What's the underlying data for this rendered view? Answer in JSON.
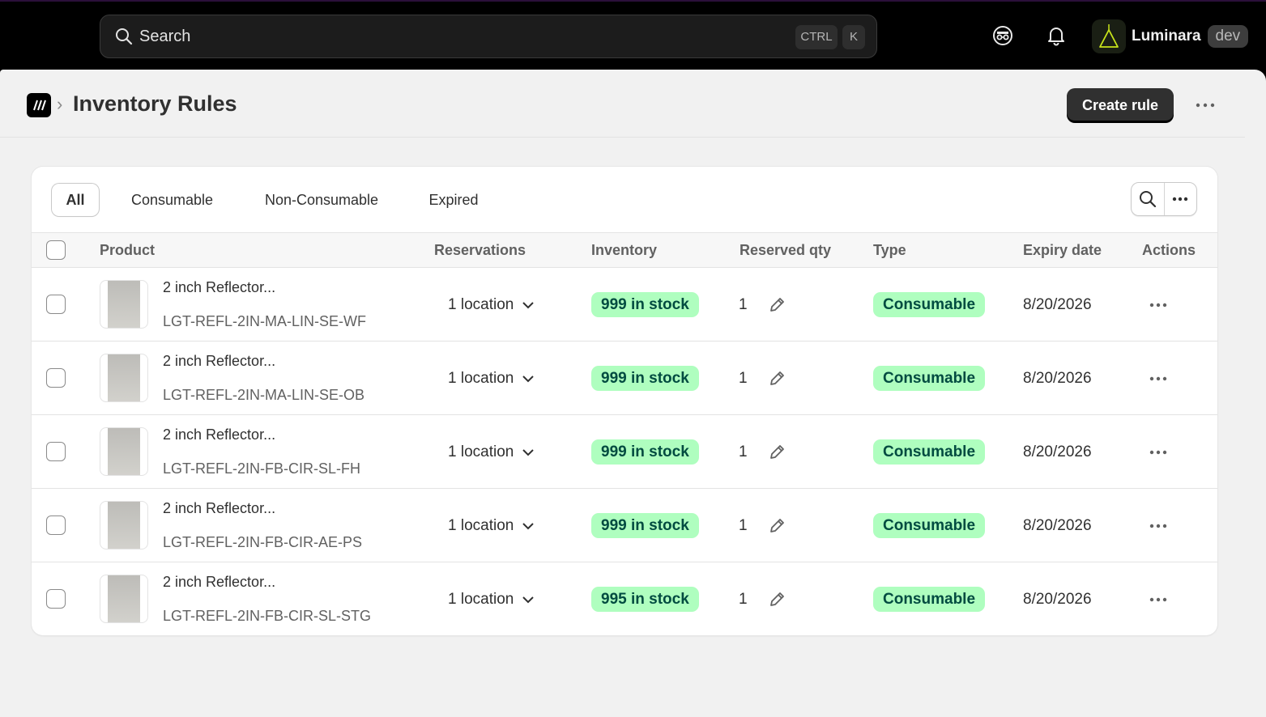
{
  "topbar": {
    "search_placeholder": "Search",
    "shortcut_ctrl": "CTRL",
    "shortcut_key": "K",
    "store_name": "Luminara",
    "store_env": "dev"
  },
  "page": {
    "title": "Inventory Rules",
    "create_button": "Create rule"
  },
  "tabs": [
    {
      "label": "All",
      "active": true
    },
    {
      "label": "Consumable",
      "active": false
    },
    {
      "label": "Non-Consumable",
      "active": false
    },
    {
      "label": "Expired",
      "active": false
    }
  ],
  "table": {
    "headers": {
      "product": "Product",
      "reservations": "Reservations",
      "inventory": "Inventory",
      "reserved_qty": "Reserved qty",
      "type": "Type",
      "expiry": "Expiry date",
      "actions": "Actions"
    },
    "rows": [
      {
        "name": "2 inch Reflector...",
        "sku": "LGT-REFL-2IN-MA-LIN-SE-WF",
        "reservations": "1 location",
        "inventory": "999 in stock",
        "reserved_qty": "1",
        "type": "Consumable",
        "expiry": "8/20/2026"
      },
      {
        "name": "2 inch Reflector...",
        "sku": "LGT-REFL-2IN-MA-LIN-SE-OB",
        "reservations": "1 location",
        "inventory": "999 in stock",
        "reserved_qty": "1",
        "type": "Consumable",
        "expiry": "8/20/2026"
      },
      {
        "name": "2 inch Reflector...",
        "sku": "LGT-REFL-2IN-FB-CIR-SL-FH",
        "reservations": "1 location",
        "inventory": "999 in stock",
        "reserved_qty": "1",
        "type": "Consumable",
        "expiry": "8/20/2026"
      },
      {
        "name": "2 inch Reflector...",
        "sku": "LGT-REFL-2IN-FB-CIR-AE-PS",
        "reservations": "1 location",
        "inventory": "999 in stock",
        "reserved_qty": "1",
        "type": "Consumable",
        "expiry": "8/20/2026"
      },
      {
        "name": "2 inch Reflector...",
        "sku": "LGT-REFL-2IN-FB-CIR-SL-STG",
        "reservations": "1 location",
        "inventory": "995 in stock",
        "reserved_qty": "1",
        "type": "Consumable",
        "expiry": "8/20/2026"
      }
    ]
  },
  "colors": {
    "badge_bg": "#affebf",
    "badge_text": "#014b40",
    "primary_button": "#303030"
  },
  "icons": [
    "search-icon",
    "incognito-icon",
    "bell-icon",
    "store-logo-icon",
    "app-icon",
    "chevron-down-icon",
    "pencil-icon",
    "more-icon"
  ]
}
